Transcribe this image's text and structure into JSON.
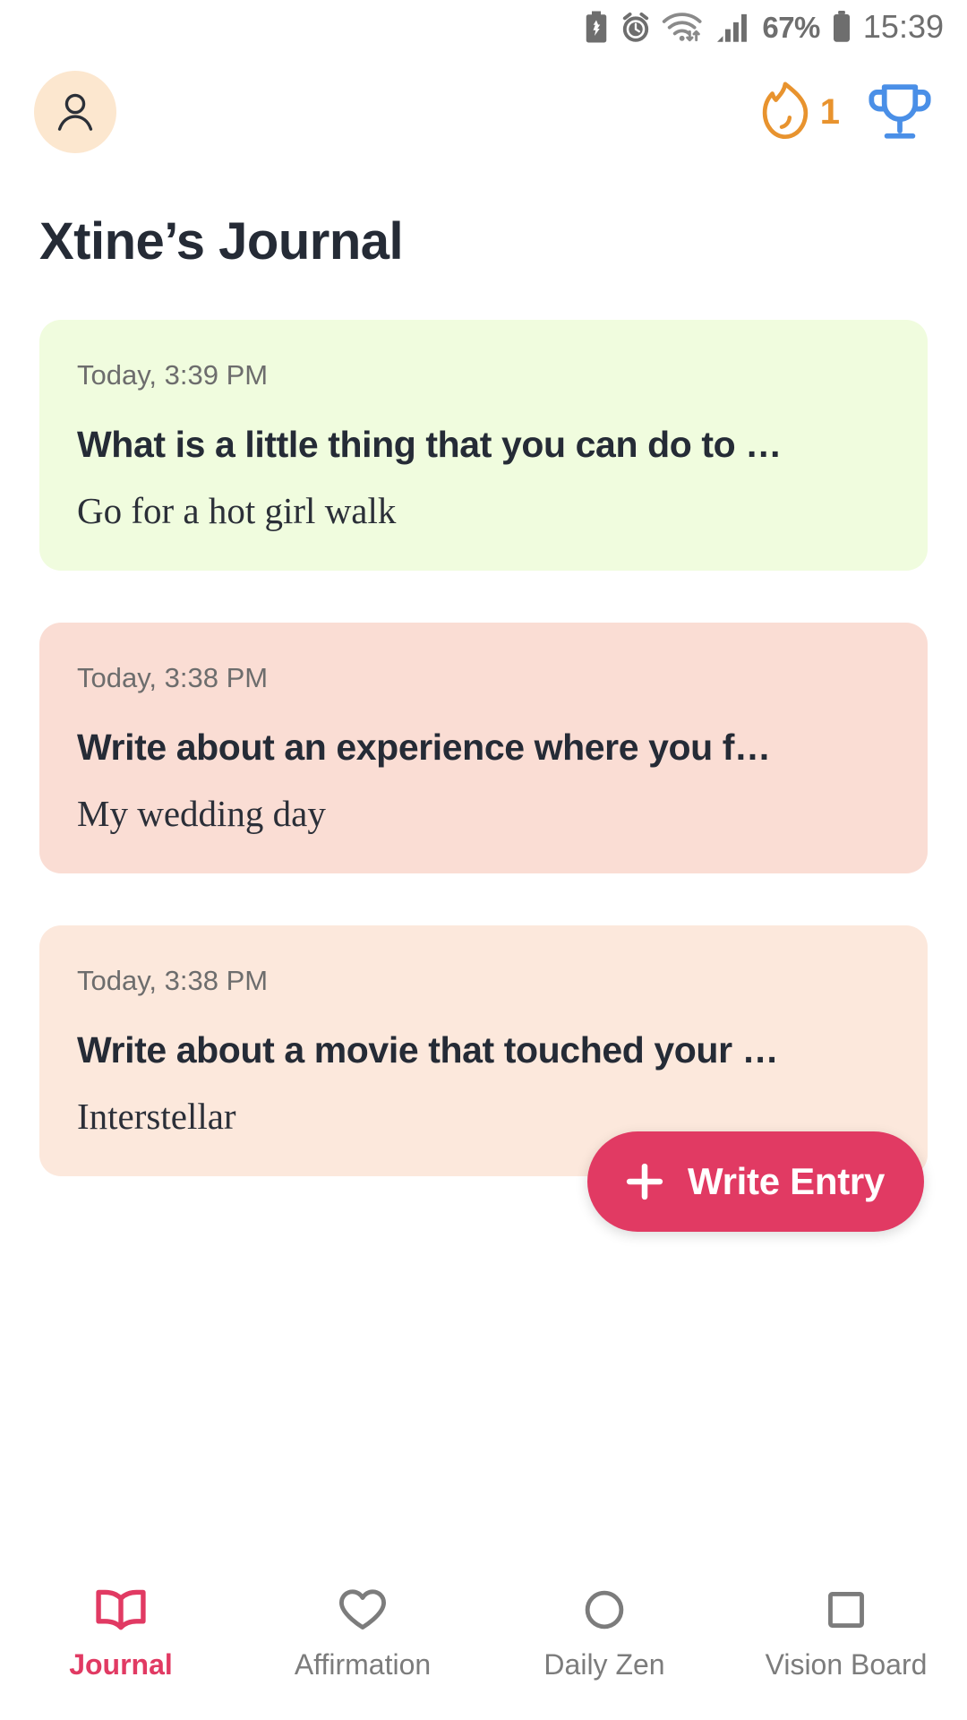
{
  "status_bar": {
    "icons": [
      "battery-saver-icon",
      "alarm-icon",
      "wifi-icon",
      "signal-icon"
    ],
    "battery_percent": "67%",
    "time": "15:39"
  },
  "top_bar": {
    "avatar": "profile-avatar",
    "streak_icon": "flame-icon",
    "streak_count": "1",
    "trophy_icon": "trophy-icon",
    "colors": {
      "avatar_bg": "#FCE7CF",
      "flame": "#E8932E",
      "trophy": "#4A8FE7"
    }
  },
  "header": {
    "title": "Xtine’s Journal"
  },
  "entries": [
    {
      "date": "Today, 3:39 PM",
      "prompt": "What is a little thing that you can do to …",
      "answer": "Go for a hot girl walk",
      "bg": "#F0FCDE"
    },
    {
      "date": "Today, 3:38 PM",
      "prompt": "Write about an experience where you f…",
      "answer": "My wedding day",
      "bg": "#FADDD4"
    },
    {
      "date": "Today, 3:38 PM",
      "prompt": "Write about a movie that touched your …",
      "answer": "Interstellar",
      "bg": "#FCE8DC"
    }
  ],
  "fab": {
    "label": "Write Entry",
    "icon": "plus-icon",
    "color": "#E13A63"
  },
  "bottom_nav": {
    "active_color": "#E13A63",
    "inactive_color": "#7c7c7c",
    "items": [
      {
        "label": "Journal",
        "icon": "open-book-icon",
        "active": true
      },
      {
        "label": "Affirmation",
        "icon": "heart-icon",
        "active": false
      },
      {
        "label": "Daily Zen",
        "icon": "circle-icon",
        "active": false
      },
      {
        "label": "Vision Board",
        "icon": "square-icon",
        "active": false
      }
    ]
  }
}
